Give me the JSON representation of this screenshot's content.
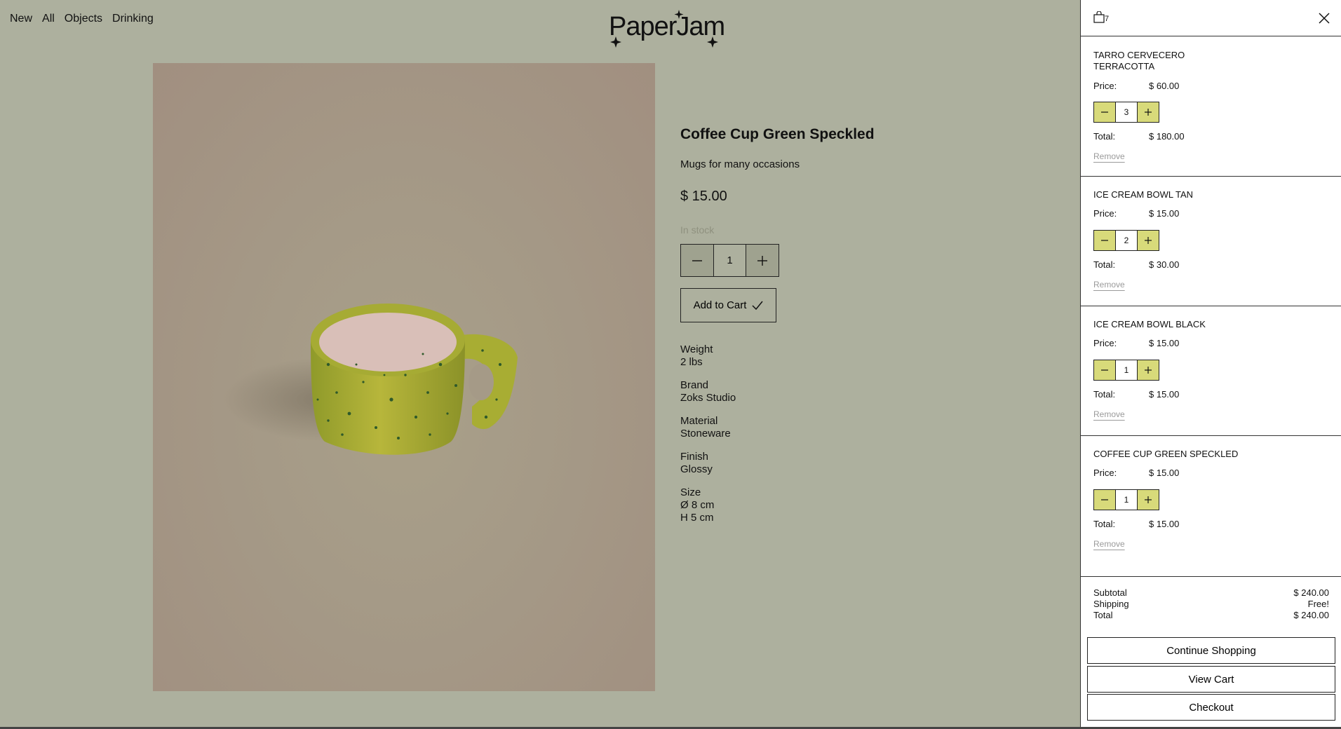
{
  "nav": {
    "items": [
      "New",
      "All",
      "Objects",
      "Drinking"
    ]
  },
  "brand": {
    "logo_text": "PaperJam"
  },
  "product": {
    "title": "Coffee Cup Green Speckled",
    "subtitle": "Mugs for many occasions",
    "price": "$ 15.00",
    "stock": "In stock",
    "quantity": "1",
    "add_to_cart": "Add to Cart",
    "specs": [
      {
        "label": "Weight",
        "lines": [
          "2 lbs"
        ]
      },
      {
        "label": "Brand",
        "lines": [
          "Zoks Studio"
        ]
      },
      {
        "label": "Material",
        "lines": [
          "Stoneware"
        ]
      },
      {
        "label": "Finish",
        "lines": [
          "Glossy"
        ]
      },
      {
        "label": "Size",
        "lines": [
          "Ø 8 cm",
          "H 5 cm"
        ]
      }
    ]
  },
  "cart": {
    "count": "7",
    "labels": {
      "price": "Price:",
      "total": "Total:",
      "remove": "Remove"
    },
    "items": [
      {
        "name_lines": [
          "TARRO CERVECERO",
          "TERRACOTTA"
        ],
        "price": "$ 60.00",
        "qty": "3",
        "total": "$ 180.00"
      },
      {
        "name_lines": [
          "ICE CREAM BOWL TAN"
        ],
        "price": "$ 15.00",
        "qty": "2",
        "total": "$ 30.00"
      },
      {
        "name_lines": [
          "ICE CREAM BOWL BLACK"
        ],
        "price": "$ 15.00",
        "qty": "1",
        "total": "$ 15.00"
      },
      {
        "name_lines": [
          "COFFEE CUP GREEN SPECKLED"
        ],
        "price": "$ 15.00",
        "qty": "1",
        "total": "$ 15.00"
      }
    ],
    "summary": {
      "subtotal_label": "Subtotal",
      "subtotal": "$ 240.00",
      "shipping_label": "Shipping",
      "shipping": "Free!",
      "total_label": "Total",
      "total": "$ 240.00"
    },
    "actions": {
      "continue": "Continue Shopping",
      "view": "View Cart",
      "checkout": "Checkout"
    }
  },
  "colors": {
    "page_bg": "#adb09e",
    "stepper_accent": "#d8da7a",
    "drawer_bg": "#ffffff"
  }
}
